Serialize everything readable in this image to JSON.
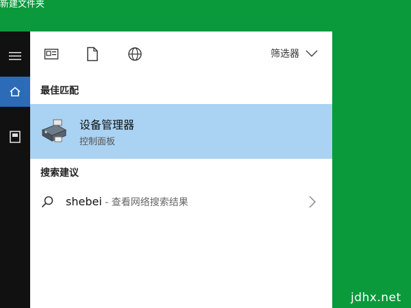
{
  "desktop": {
    "partial_label": "新建文件夹",
    "watermark": "jdhx.net"
  },
  "sidebar": {
    "items": [
      {
        "icon": "hamburger-menu-icon"
      },
      {
        "icon": "home-icon",
        "active": true
      },
      {
        "icon": "document-icon"
      }
    ],
    "active_color": "#2b6bb8"
  },
  "toolbar": {
    "icons": [
      "apps-icon",
      "documents-icon",
      "web-icon"
    ],
    "filter_label": "筛选器"
  },
  "best_match": {
    "section_label": "最佳匹配",
    "title": "设备管理器",
    "subtitle": "控制面板",
    "highlight_color": "#a9d2f3"
  },
  "search_suggestions": {
    "section_label": "搜索建议",
    "items": [
      {
        "query": "shebei",
        "hint": " - 查看网络搜索结果"
      }
    ]
  },
  "colors": {
    "desktop_bg": "#0a9a3c",
    "sidebar_bg": "#111111",
    "panel_bg": "#ffffff"
  }
}
